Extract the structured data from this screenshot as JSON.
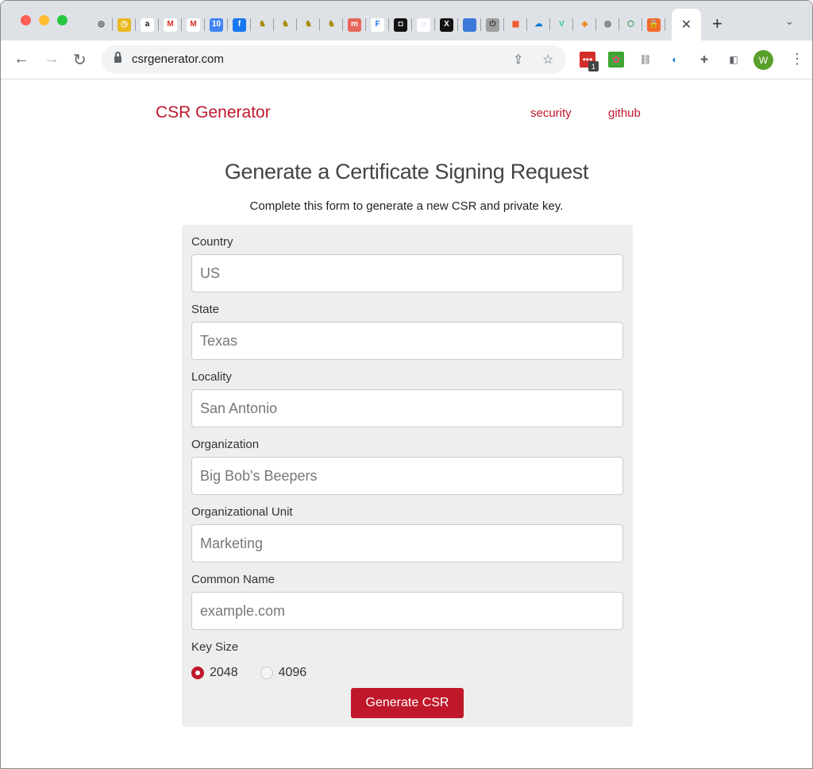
{
  "browser": {
    "tab_favicons": [
      {
        "name": "target-tab-icon",
        "glyph": "◎",
        "bg": "transparent",
        "fg": "#333"
      },
      {
        "name": "clock-tab-icon",
        "glyph": "◷",
        "bg": "#e8b820",
        "fg": "#fff"
      },
      {
        "name": "amazon-tab-icon",
        "glyph": "a",
        "bg": "#fff",
        "fg": "#111"
      },
      {
        "name": "gmail-100-tab-icon",
        "glyph": "M",
        "bg": "#fff",
        "fg": "#d93025"
      },
      {
        "name": "gmail-tab-icon",
        "glyph": "M",
        "bg": "#fff",
        "fg": "#d93025"
      },
      {
        "name": "calendar-tab-icon",
        "glyph": "10",
        "bg": "#4285f4",
        "fg": "#fff"
      },
      {
        "name": "facebook-tab-icon",
        "glyph": "f",
        "bg": "#1877f2",
        "fg": "#fff"
      },
      {
        "name": "coins-tab-icon",
        "glyph": "♞",
        "bg": "transparent",
        "fg": "#a68a00"
      },
      {
        "name": "coins-tab-icon",
        "glyph": "♞",
        "bg": "transparent",
        "fg": "#a68a00"
      },
      {
        "name": "coins-tab-icon",
        "glyph": "♞",
        "bg": "transparent",
        "fg": "#a68a00"
      },
      {
        "name": "coins-tab-icon",
        "glyph": "♞",
        "bg": "transparent",
        "fg": "#a68a00"
      },
      {
        "name": "m-tab-icon",
        "glyph": "m",
        "bg": "#e8665a",
        "fg": "#fff"
      },
      {
        "name": "f-tab-icon",
        "glyph": "F",
        "bg": "#fff",
        "fg": "#1a73e8"
      },
      {
        "name": "square-tab-icon",
        "glyph": "◘",
        "bg": "#111",
        "fg": "#fff"
      },
      {
        "name": "spiral-tab-icon",
        "glyph": "◌",
        "bg": "#fff",
        "fg": "#4285f4"
      },
      {
        "name": "x-tab-icon",
        "glyph": "X",
        "bg": "#111",
        "fg": "#fff"
      },
      {
        "name": "blue-square-tab-icon",
        "glyph": "",
        "bg": "#3c78d8",
        "fg": "#fff"
      },
      {
        "name": "power-tab-icon",
        "glyph": "⏻",
        "bg": "#9e9e9e",
        "fg": "#333"
      },
      {
        "name": "microsoft-tab-icon",
        "glyph": "▦",
        "bg": "transparent",
        "fg": "#f25022"
      },
      {
        "name": "onedrive-tab-icon",
        "glyph": "☁",
        "bg": "transparent",
        "fg": "#0078d4"
      },
      {
        "name": "v-tab-icon",
        "glyph": "V",
        "bg": "transparent",
        "fg": "#2bd1a4"
      },
      {
        "name": "cube-tab-icon",
        "glyph": "◆",
        "bg": "transparent",
        "fg": "#f28c28"
      },
      {
        "name": "target-tab-icon",
        "glyph": "◎",
        "bg": "transparent",
        "fg": "#333"
      },
      {
        "name": "hexagon-tab-icon",
        "glyph": "⬡",
        "bg": "transparent",
        "fg": "#2e9b4f"
      },
      {
        "name": "lock-tab-icon",
        "glyph": "🔒",
        "bg": "#f26b2a",
        "fg": "#fff"
      }
    ],
    "active_tab_close": "✕",
    "new_tab": "+",
    "tab_dropdown": "⌄",
    "back": "←",
    "forward": "→",
    "reload": "↻",
    "url": "csrgenerator.com",
    "share": "⇪",
    "bookmark": "☆",
    "extensions": [
      {
        "name": "lastpass-extension-icon",
        "glyph": "•••",
        "bg": "#d32d27",
        "fg": "#fff",
        "badge": "1"
      },
      {
        "name": "pink-extension-icon",
        "glyph": "✿",
        "bg": "#3fa535",
        "fg": "#e94b8a"
      },
      {
        "name": "link-extension-icon",
        "glyph": "⛓",
        "bg": "transparent",
        "fg": "#555"
      },
      {
        "name": "privacy-extension-icon",
        "glyph": "◐",
        "bg": "transparent",
        "fg": "#1a73e8"
      },
      {
        "name": "puzzle-extension-icon",
        "glyph": "✚",
        "bg": "transparent",
        "fg": "#5f6368"
      },
      {
        "name": "side-panel-icon",
        "glyph": "◧",
        "bg": "transparent",
        "fg": "#5f6368"
      }
    ],
    "profile_initial": "W",
    "menu": "⋮"
  },
  "site": {
    "brand": "CSR Generator",
    "nav": [
      {
        "label": "security"
      },
      {
        "label": "github"
      }
    ],
    "accent": "#c0182b"
  },
  "main": {
    "title": "Generate a Certificate Signing Request",
    "subtitle": "Complete this form to generate a new CSR and private key.",
    "fields": [
      {
        "label": "Country",
        "value": "",
        "placeholder": "US"
      },
      {
        "label": "State",
        "value": "",
        "placeholder": "Texas"
      },
      {
        "label": "Locality",
        "value": "",
        "placeholder": "San Antonio"
      },
      {
        "label": "Organization",
        "value": "",
        "placeholder": "Big Bob's Beepers"
      },
      {
        "label": "Organizational Unit",
        "value": "",
        "placeholder": "Marketing"
      },
      {
        "label": "Common Name",
        "value": "",
        "placeholder": "example.com"
      }
    ],
    "key_size": {
      "label": "Key Size",
      "options": [
        {
          "label": "2048",
          "checked": true
        },
        {
          "label": "4096",
          "checked": false
        }
      ]
    },
    "submit_label": "Generate CSR"
  }
}
